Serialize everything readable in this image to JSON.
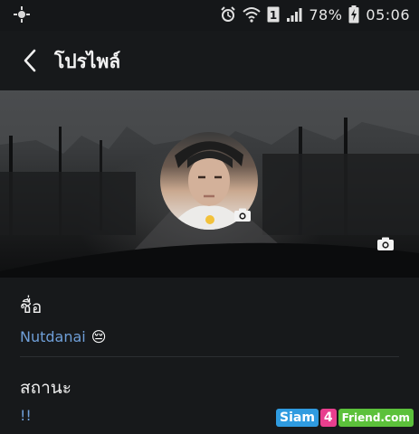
{
  "status_bar": {
    "battery_percent": "78%",
    "time": "05:06",
    "icons": [
      "notification-icon",
      "alarm-icon",
      "wifi-icon",
      "sim-icon",
      "signal-icon",
      "battery-charging-icon"
    ]
  },
  "header": {
    "back_icon": "chevron-left-icon",
    "title": "โปรไพล์"
  },
  "profile": {
    "cover_camera_icon": "camera-icon",
    "avatar_camera_icon": "camera-icon",
    "name_label": "ชื่อ",
    "name_value": "Nutdanai",
    "name_emoji": "😔",
    "status_label": "สถานะ",
    "status_value": "!!"
  },
  "watermark": {
    "part1": "Siam",
    "part2": "4",
    "part3": "Friend.com"
  },
  "colors": {
    "background": "#17191b",
    "value_text": "#6f9fd8"
  }
}
